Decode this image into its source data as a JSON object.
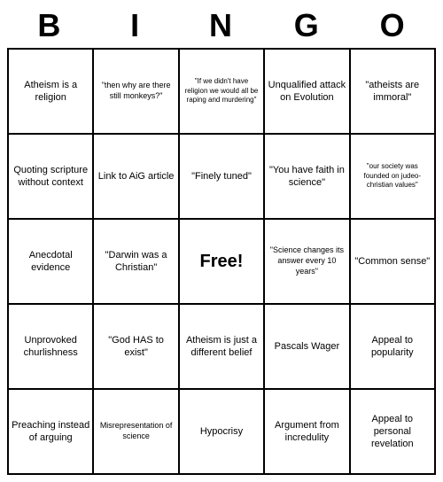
{
  "title": {
    "letters": [
      "B",
      "I",
      "N",
      "G",
      "O"
    ]
  },
  "cells": [
    {
      "text": "Atheism is a religion",
      "size": "normal"
    },
    {
      "text": "\"then why are there still monkeys?\"",
      "size": "small"
    },
    {
      "text": "\"If we didn't have religion we would all be raping and murdering\"",
      "size": "tiny"
    },
    {
      "text": "Unqualified attack on Evolution",
      "size": "normal"
    },
    {
      "text": "\"atheists are immoral\"",
      "size": "normal"
    },
    {
      "text": "Quoting scripture without context",
      "size": "normal"
    },
    {
      "text": "Link to AiG article",
      "size": "normal"
    },
    {
      "text": "\"Finely tuned\"",
      "size": "normal"
    },
    {
      "text": "\"You have faith in science\"",
      "size": "normal"
    },
    {
      "text": "\"our society was founded on judeo-christian values\"",
      "size": "tiny"
    },
    {
      "text": "Anecdotal evidence",
      "size": "normal"
    },
    {
      "text": "\"Darwin was a Christian\"",
      "size": "normal"
    },
    {
      "text": "Free!",
      "size": "free"
    },
    {
      "text": "\"Science changes its answer every 10 years\"",
      "size": "small"
    },
    {
      "text": "\"Common sense\"",
      "size": "normal"
    },
    {
      "text": "Unprovoked churlishness",
      "size": "normal"
    },
    {
      "text": "\"God HAS to exist\"",
      "size": "normal"
    },
    {
      "text": "Atheism is just a different belief",
      "size": "normal"
    },
    {
      "text": "Pascals Wager",
      "size": "normal"
    },
    {
      "text": "Appeal to popularity",
      "size": "normal"
    },
    {
      "text": "Preaching instead of arguing",
      "size": "normal"
    },
    {
      "text": "Misrepresentation of science",
      "size": "small"
    },
    {
      "text": "Hypocrisy",
      "size": "normal"
    },
    {
      "text": "Argument from incredulity",
      "size": "normal"
    },
    {
      "text": "Appeal to personal revelation",
      "size": "normal"
    }
  ]
}
